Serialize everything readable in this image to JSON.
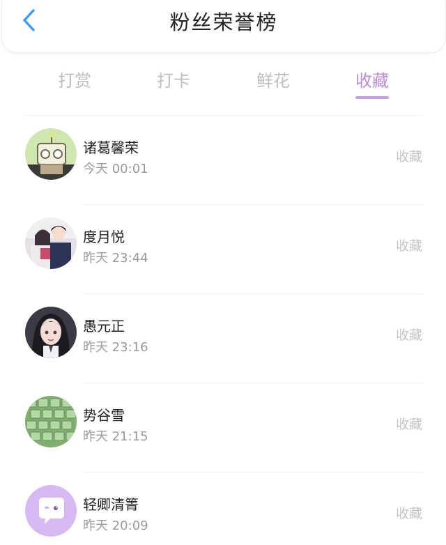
{
  "header": {
    "title": "粉丝荣誉榜",
    "back_icon": "chevron-left-icon",
    "accent_color": "#3b9af2"
  },
  "tabs": [
    {
      "label": "打赏",
      "active": false
    },
    {
      "label": "打卡",
      "active": false
    },
    {
      "label": "鲜花",
      "active": false
    },
    {
      "label": "收藏",
      "active": true
    }
  ],
  "colors": {
    "active_tab": "#b98bd9",
    "inactive_tab": "#bdbdbd",
    "underline": "#c79be6"
  },
  "fans": [
    {
      "name": "诸葛馨荣",
      "time": "今天 00:01",
      "action": "收藏",
      "avatar": "robot-cartoon-avatar"
    },
    {
      "name": "度月悦",
      "time": "昨天 23:44",
      "action": "收藏",
      "avatar": "couple-photo-avatar"
    },
    {
      "name": "愚元正",
      "time": "昨天 23:16",
      "action": "收藏",
      "avatar": "anime-girl-avatar"
    },
    {
      "name": "势谷雪",
      "time": "昨天 21:15",
      "action": "收藏",
      "avatar": "green-keyboard-avatar"
    },
    {
      "name": "轻卿清箐",
      "time": "昨天 20:09",
      "action": "收藏",
      "avatar": "default-chat-avatar"
    }
  ]
}
